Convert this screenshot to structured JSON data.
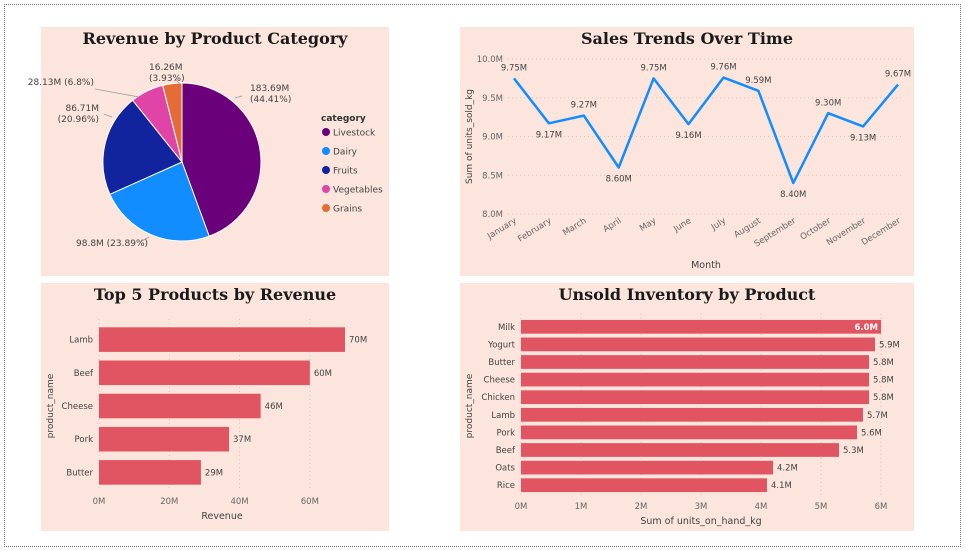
{
  "chart_data": [
    {
      "id": "pie",
      "type": "pie",
      "title": "Revenue by Product Category",
      "legend_title": "category",
      "legend_position": "right",
      "slices": [
        {
          "name": "Livestock",
          "value": 183.69,
          "label": [
            "183.69M",
            "(44.41%)"
          ],
          "color": "#6b007b"
        },
        {
          "name": "Dairy",
          "value": 98.8,
          "label": [
            "98.8M (23.89%)"
          ],
          "color": "#118dff"
        },
        {
          "name": "Fruits",
          "value": 86.71,
          "label": [
            "86.71M",
            "(20.96%)"
          ],
          "color": "#12239e"
        },
        {
          "name": "Vegetables",
          "value": 28.13,
          "label": [
            "28.13M (6.8%)"
          ],
          "color": "#e044a7"
        },
        {
          "name": "Grains",
          "value": 16.26,
          "label": [
            "16.26M",
            "(3.93%)"
          ],
          "color": "#e66c37"
        }
      ]
    },
    {
      "id": "line",
      "type": "line",
      "title": "Sales Trends Over Time",
      "xlabel": "Month",
      "ylabel": "Sum of units_sold_kg",
      "ylim": [
        8.0,
        10.0
      ],
      "yticks": [
        "8.0M",
        "8.5M",
        "9.0M",
        "9.5M",
        "10.0M"
      ],
      "grid": true,
      "color": "#118dff",
      "categories": [
        "January",
        "February",
        "March",
        "April",
        "May",
        "June",
        "July",
        "August",
        "September",
        "October",
        "November",
        "December"
      ],
      "values": [
        9.75,
        9.17,
        9.27,
        8.6,
        9.75,
        9.16,
        9.76,
        9.59,
        8.4,
        9.3,
        9.13,
        9.67
      ],
      "labels": [
        "9.75M",
        "9.17M",
        "9.27M",
        "8.60M",
        "9.75M",
        "9.16M",
        "9.76M",
        "9.59M",
        "8.40M",
        "9.30M",
        "9.13M",
        "9.67M"
      ]
    },
    {
      "id": "top5",
      "type": "bar",
      "orientation": "horizontal",
      "title": "Top 5 Products by Revenue",
      "xlabel": "Revenue",
      "ylabel": "product_name",
      "xlim": [
        0,
        70
      ],
      "xticks": [
        "0M",
        "20M",
        "40M",
        "60M"
      ],
      "grid": true,
      "color": "#e15562",
      "categories": [
        "Lamb",
        "Beef",
        "Cheese",
        "Pork",
        "Butter"
      ],
      "values": [
        70,
        60,
        46,
        37,
        29
      ],
      "labels": [
        "70M",
        "60M",
        "46M",
        "37M",
        "29M"
      ]
    },
    {
      "id": "unsold",
      "type": "bar",
      "orientation": "horizontal",
      "title": "Unsold Inventory by Product",
      "xlabel": "Sum of units_on_hand_kg",
      "ylabel": "product_name",
      "xlim": [
        0,
        6
      ],
      "xticks": [
        "0M",
        "1M",
        "2M",
        "3M",
        "4M",
        "5M",
        "6M"
      ],
      "grid": true,
      "color": "#e15562",
      "categories": [
        "Milk",
        "Yogurt",
        "Butter",
        "Cheese",
        "Chicken",
        "Lamb",
        "Pork",
        "Beef",
        "Oats",
        "Rice"
      ],
      "values": [
        6.0,
        5.9,
        5.8,
        5.8,
        5.8,
        5.7,
        5.6,
        5.3,
        4.2,
        4.1
      ],
      "labels": [
        "6.0M",
        "5.9M",
        "5.8M",
        "5.8M",
        "5.8M",
        "5.7M",
        "5.6M",
        "5.3M",
        "4.2M",
        "4.1M"
      ]
    }
  ]
}
